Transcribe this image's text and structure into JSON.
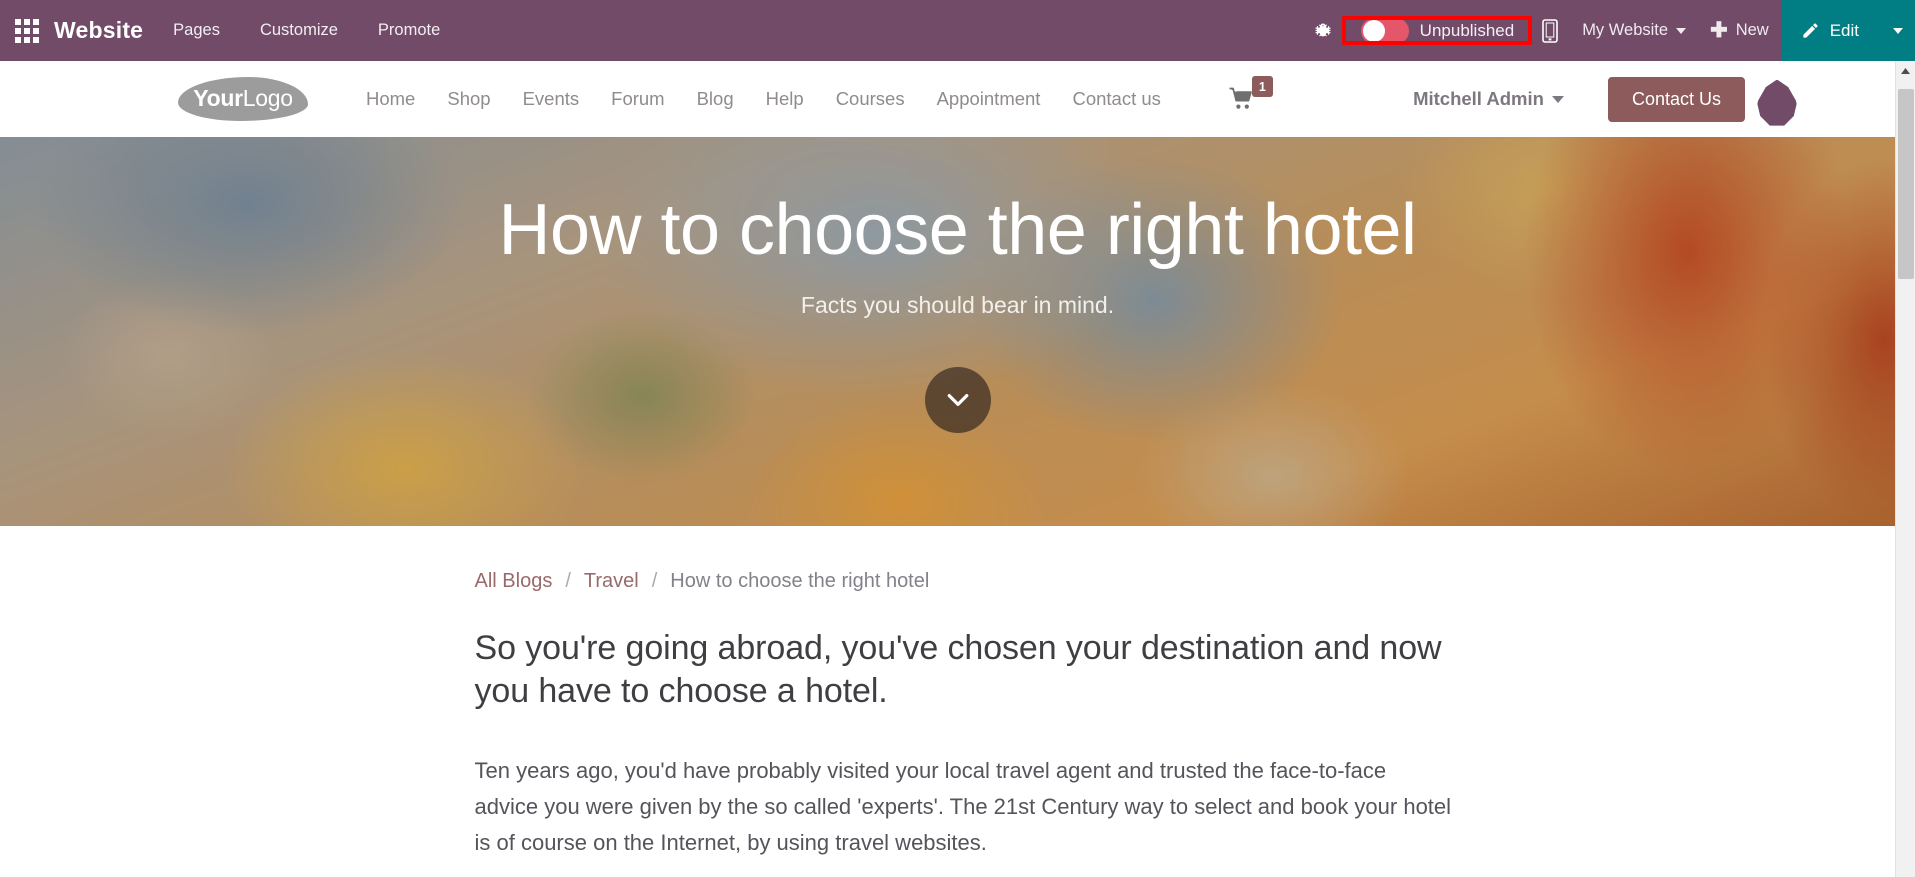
{
  "backend": {
    "apps_icon": "apps-grid-icon",
    "brand": "Website",
    "menus": [
      {
        "label": "Pages"
      },
      {
        "label": "Customize"
      },
      {
        "label": "Promote"
      }
    ],
    "systray": {
      "debug_icon": "bug-icon",
      "publish_toggle": {
        "label": "Unpublished",
        "state": "off",
        "toggle_color": "#E4576A",
        "highlight_color": "#FF0000"
      },
      "mobile_preview_icon": "mobile-phone-icon",
      "website_switcher": "My Website",
      "new_button": "New",
      "new_icon": "plus-icon",
      "edit_button": "Edit",
      "edit_icon": "pencil-icon",
      "edit_color": "#017E84"
    },
    "navbar_color": "#714B67"
  },
  "site_header": {
    "logo": {
      "bold": "Your",
      "light": "Logo"
    },
    "nav": [
      {
        "label": "Home"
      },
      {
        "label": "Shop"
      },
      {
        "label": "Events"
      },
      {
        "label": "Forum"
      },
      {
        "label": "Blog"
      },
      {
        "label": "Help"
      },
      {
        "label": "Courses"
      },
      {
        "label": "Appointment"
      },
      {
        "label": "Contact us"
      }
    ],
    "cart": {
      "icon": "shopping-cart-icon",
      "count": "1"
    },
    "user": "Mitchell Admin",
    "cta": "Contact Us",
    "cta_color": "#8d5b5b",
    "marker_icon": "location-drop-marker-icon"
  },
  "hero": {
    "title": "How to choose the right hotel",
    "subtitle": "Facts you should bear in mind.",
    "scroll_icon": "chevron-down-icon"
  },
  "breadcrumb": {
    "root": "All Blogs",
    "separator": "/",
    "category": "Travel",
    "current": "How to choose the right hotel"
  },
  "article": {
    "lead": "So you're going abroad, you've chosen your destination and now you have to choose a hotel.",
    "paragraph_1": "Ten years ago, you'd have probably visited your local travel agent and trusted the face-to-face advice you were given by the so called 'experts'. The 21st Century way to select and book your hotel is of course on the Internet, by using travel websites."
  }
}
